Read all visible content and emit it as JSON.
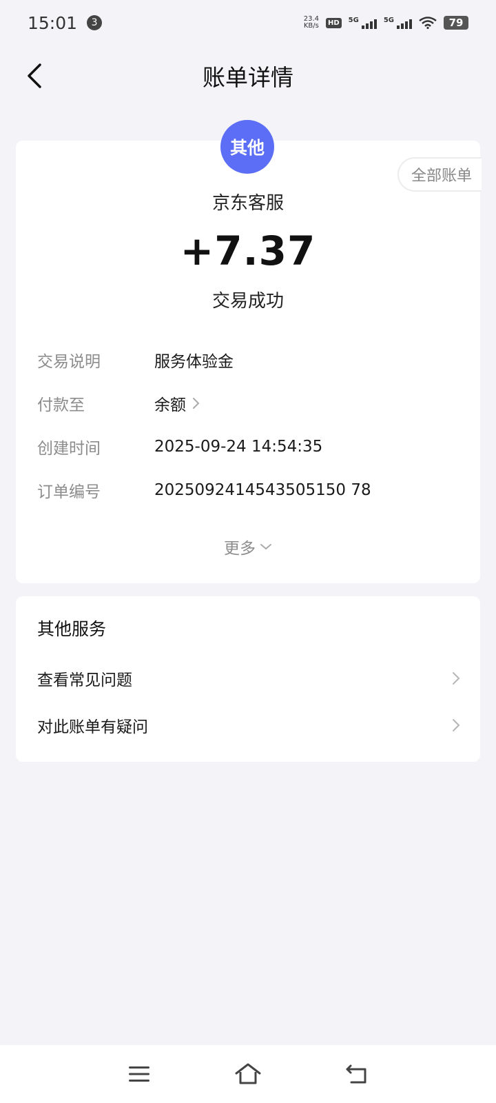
{
  "status_bar": {
    "time": "15:01",
    "notification_count": "3",
    "net_speed_value": "23.4",
    "net_speed_unit": "KB/s",
    "hd_label": "HD",
    "signal1_label": "5G",
    "signal2_label": "5G",
    "battery": "79"
  },
  "header": {
    "title": "账单详情"
  },
  "bill": {
    "avatar_text": "其他",
    "all_bills_label": "全部账单",
    "merchant": "京东客服",
    "amount": "+7.37",
    "status": "交易成功",
    "details": [
      {
        "label": "交易说明",
        "value": "服务体验金"
      },
      {
        "label": "付款至",
        "value": "余额"
      },
      {
        "label": "创建时间",
        "value": "2025-09-24 14:54:35"
      },
      {
        "label": "订单编号",
        "value": "2025092414543505150 78"
      }
    ],
    "more_label": "更多"
  },
  "services": {
    "title": "其他服务",
    "items": [
      {
        "label": "查看常见问题"
      },
      {
        "label": "对此账单有疑问"
      }
    ]
  },
  "icons": {
    "back": "back-arrow-icon",
    "chevron": "chevron-right-icon",
    "menu": "menu-icon",
    "home": "home-icon",
    "return": "return-icon"
  }
}
